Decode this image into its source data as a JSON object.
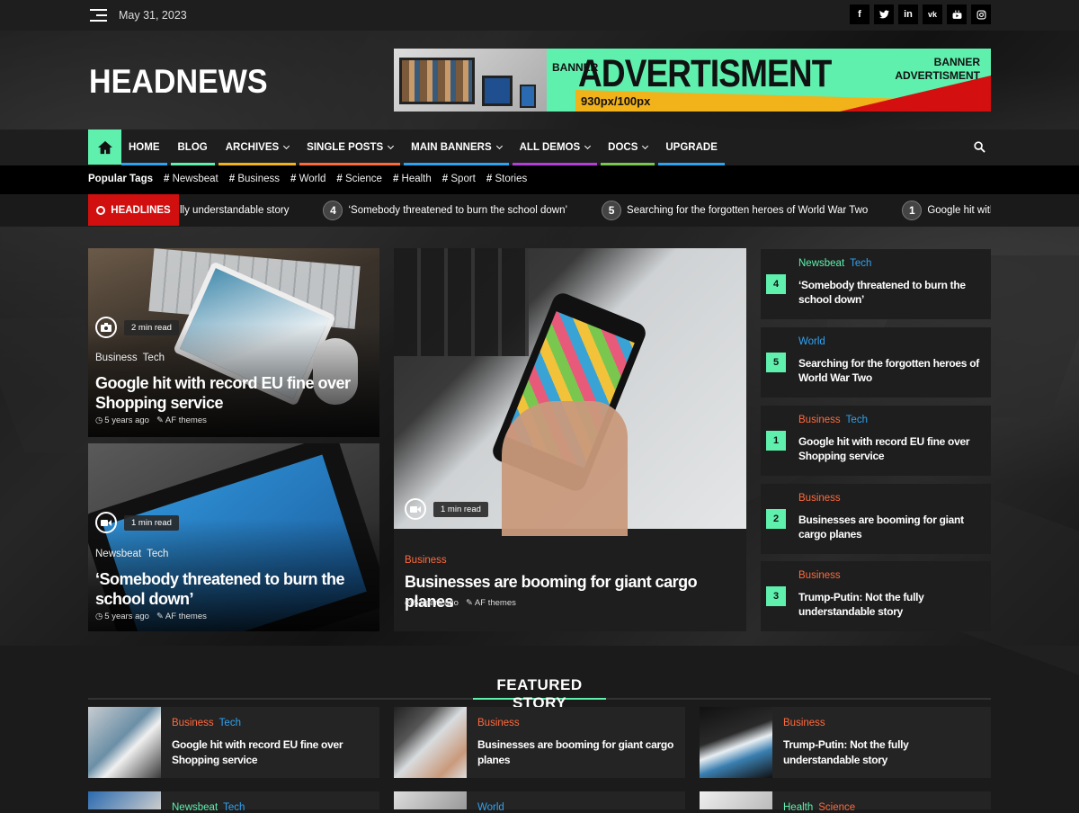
{
  "topbar": {
    "date": "May 31, 2023",
    "social": [
      "f",
      "t",
      "in",
      "vk",
      "yt",
      "ig"
    ]
  },
  "site": {
    "logo": "HEADNEWS"
  },
  "ad": {
    "banner_left": "BANNER",
    "title": "ADVERTISMENT",
    "size": "930px/100px",
    "banner_right_1": "BANNER",
    "banner_right_2": "ADVERTISMENT"
  },
  "nav": {
    "items": [
      {
        "label": "HOME",
        "color": "#2ea3f2",
        "caret": false
      },
      {
        "label": "BLOG",
        "color": "#5ff0ae",
        "caret": false
      },
      {
        "label": "ARCHIVES",
        "color": "#f2b21a",
        "caret": true
      },
      {
        "label": "SINGLE POSTS",
        "color": "#ff6a3d",
        "caret": true
      },
      {
        "label": "MAIN BANNERS",
        "color": "#2ea3f2",
        "caret": true
      },
      {
        "label": "ALL DEMOS",
        "color": "#b43fd6",
        "caret": true
      },
      {
        "label": "DOCS",
        "color": "#7ac74f",
        "caret": true
      },
      {
        "label": "UPGRADE",
        "color": "#2ea3f2",
        "caret": false
      }
    ]
  },
  "tags": {
    "label": "Popular Tags",
    "items": [
      "Newsbeat",
      "Business",
      "World",
      "Science",
      "Health",
      "Sport",
      "Stories"
    ]
  },
  "ticker": {
    "label": "HEADLINES",
    "items": [
      {
        "num": "",
        "text": "lly understandable story"
      },
      {
        "num": "4",
        "text": "‘Somebody threatened to burn the school down’"
      },
      {
        "num": "5",
        "text": "Searching for the forgotten heroes of World War Two"
      },
      {
        "num": "1",
        "text": "Google hit with r"
      }
    ]
  },
  "main": {
    "left_top": {
      "read": "2 min read",
      "cats": [
        "Business",
        "Tech"
      ],
      "title": "Google hit with record EU fine over Shopping service",
      "time": "5 years ago",
      "author": "AF themes"
    },
    "left_bottom": {
      "read": "1 min read",
      "cats": [
        "Newsbeat",
        "Tech"
      ],
      "title": "‘Somebody threatened to burn the school down’",
      "time": "5 years ago",
      "author": "AF themes"
    },
    "center": {
      "read": "1 min read",
      "cats": [
        "Business"
      ],
      "title": "Businesses are booming for giant cargo planes",
      "time": "5 years ago",
      "author": "AF themes"
    }
  },
  "side": [
    {
      "num": "4",
      "cats": [
        "Newsbeat",
        "Tech"
      ],
      "title": "‘Somebody threatened to burn the school down’"
    },
    {
      "num": "5",
      "cats": [
        "World"
      ],
      "title": "Searching for the forgotten heroes of World War Two"
    },
    {
      "num": "1",
      "cats": [
        "Business",
        "Tech"
      ],
      "title": "Google hit with record EU fine over Shopping service"
    },
    {
      "num": "2",
      "cats": [
        "Business"
      ],
      "title": "Businesses are booming for giant cargo planes"
    },
    {
      "num": "3",
      "cats": [
        "Business"
      ],
      "title": "Trump-Putin: Not the fully understandable story"
    }
  ],
  "featured": {
    "title": "FEATURED STORY",
    "items": [
      {
        "cats": [
          "Business",
          "Tech"
        ],
        "title": "Google hit with record EU fine over Shopping service"
      },
      {
        "cats": [
          "Business"
        ],
        "title": "Businesses are booming for giant cargo planes"
      },
      {
        "cats": [
          "Business"
        ],
        "title": "Trump-Putin: Not the fully understandable story"
      }
    ],
    "second_row": [
      {
        "cats": [
          "Newsbeat",
          "Tech"
        ]
      },
      {
        "cats": [
          "World"
        ]
      },
      {
        "cats": [
          "Health",
          "Science"
        ]
      }
    ]
  }
}
